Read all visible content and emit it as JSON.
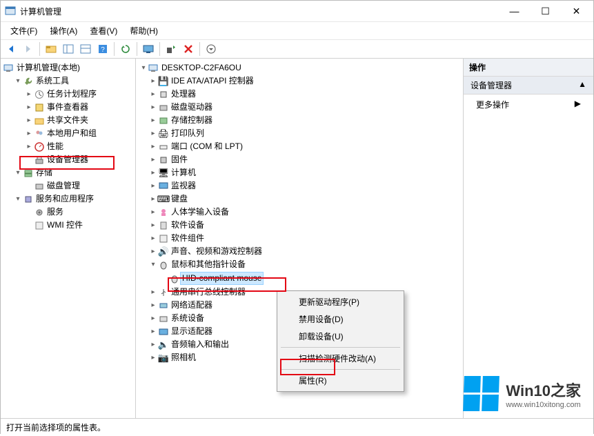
{
  "window": {
    "title": "计算机管理",
    "minimize": "—",
    "maximize": "☐",
    "close": "✕"
  },
  "menu": {
    "file": "文件(F)",
    "action": "操作(A)",
    "view": "查看(V)",
    "help": "帮助(H)"
  },
  "left_tree": {
    "root": "计算机管理(本地)",
    "systools": "系统工具",
    "task": "任务计划程序",
    "event": "事件查看器",
    "share": "共享文件夹",
    "users": "本地用户和组",
    "perf": "性能",
    "devmgr": "设备管理器",
    "storage": "存储",
    "diskmgr": "磁盘管理",
    "services_apps": "服务和应用程序",
    "services": "服务",
    "wmi": "WMI 控件"
  },
  "mid_tree": {
    "root": "DESKTOP-C2FA6OU",
    "ide": "IDE ATA/ATAPI 控制器",
    "cpu": "处理器",
    "disk": "磁盘驱动器",
    "storage": "存储控制器",
    "printq": "打印队列",
    "ports": "端口 (COM 和 LPT)",
    "firmware": "固件",
    "computer": "计算机",
    "monitor": "监视器",
    "keyboard": "键盘",
    "hid": "人体学输入设备",
    "software": "软件设备",
    "softcomp": "软件组件",
    "sound": "声音、视频和游戏控制器",
    "mouse_cat": "鼠标和其他指针设备",
    "mouse_item": "HID-compliant mouse",
    "usb": "通用串行总线控制器",
    "network": "网络适配器",
    "sysdev": "系统设备",
    "display": "显示适配器",
    "audio": "音频输入和输出",
    "camera": "照相机"
  },
  "ctx": {
    "update": "更新驱动程序(P)",
    "disable": "禁用设备(D)",
    "uninstall": "卸载设备(U)",
    "scan": "扫描检测硬件改动(A)",
    "properties": "属性(R)"
  },
  "right": {
    "header": "操作",
    "category": "设备管理器",
    "more": "更多操作"
  },
  "status": "打开当前选择项的属性表。",
  "watermark": {
    "brand": "Win10之家",
    "url": "www.win10xitong.com"
  }
}
